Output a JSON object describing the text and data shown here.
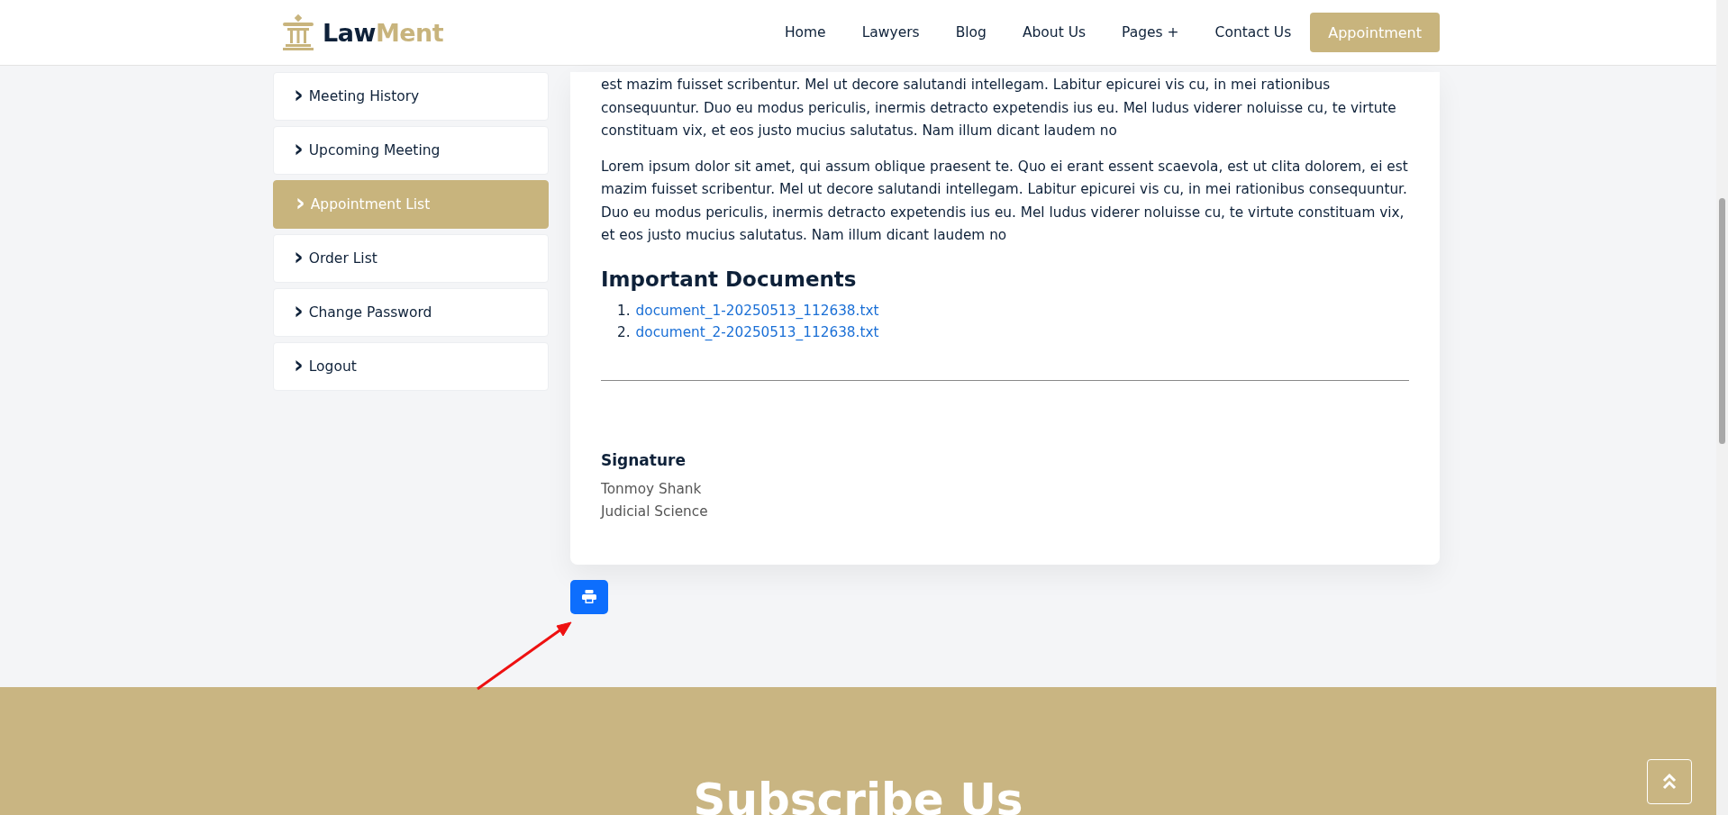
{
  "header": {
    "logo": {
      "parts": [
        "Law",
        "Ment"
      ]
    },
    "nav": [
      {
        "label": "Home",
        "kind": "link"
      },
      {
        "label": "Lawyers",
        "kind": "link"
      },
      {
        "label": "Blog",
        "kind": "link"
      },
      {
        "label": "About Us",
        "kind": "link"
      },
      {
        "label": "Pages +",
        "kind": "link"
      },
      {
        "label": "Contact Us",
        "kind": "link"
      },
      {
        "label": "Appointment",
        "kind": "button"
      }
    ]
  },
  "sidebar": {
    "items": [
      {
        "icon": "›",
        "label": "Meeting History",
        "selected": false
      },
      {
        "icon": "›",
        "label": "Upcoming Meeting",
        "selected": false
      },
      {
        "icon": "›",
        "label": "Appointment List",
        "selected": true
      },
      {
        "icon": "›",
        "label": "Order List",
        "selected": false
      },
      {
        "icon": "›",
        "label": "Change Password",
        "selected": false
      },
      {
        "icon": "›",
        "label": "Logout",
        "selected": false
      }
    ]
  },
  "document": {
    "paragraphs": [
      "est mazim fuisset scribentur. Mel ut decore salutandi intellegam. Labitur epicurei vis cu, in mei rationibus consequuntur. Duo eu modus periculis, inermis detracto expetendis ius eu. Mel ludus viderer noluisse cu, te virtute constituam vix, et eos justo mucius salutatus. Nam illum dicant laudem no",
      "Lorem ipsum dolor sit amet, qui assum oblique praesent te. Quo ei erant essent scaevola, est ut clita dolorem, ei est mazim fuisset scribentur. Mel ut decore salutandi intellegam. Labitur epicurei vis cu, in mei rationibus consequuntur. Duo eu modus periculis, inermis detracto expetendis ius eu. Mel ludus viderer noluisse cu, te virtute constituam vix, et eos justo mucius salutatus. Nam illum dicant laudem no"
    ],
    "documents_title": "Important Documents",
    "documents": [
      {
        "number": "1.",
        "name": "document_1-20250513_112638.txt"
      },
      {
        "number": "2.",
        "name": "document_2-20250513_112638.txt"
      }
    ],
    "signature": {
      "title": "Signature",
      "name": "Tonmoy Shank",
      "position": "Judicial Science"
    }
  },
  "subscribe": {
    "title": "Subscribe Us"
  }
}
